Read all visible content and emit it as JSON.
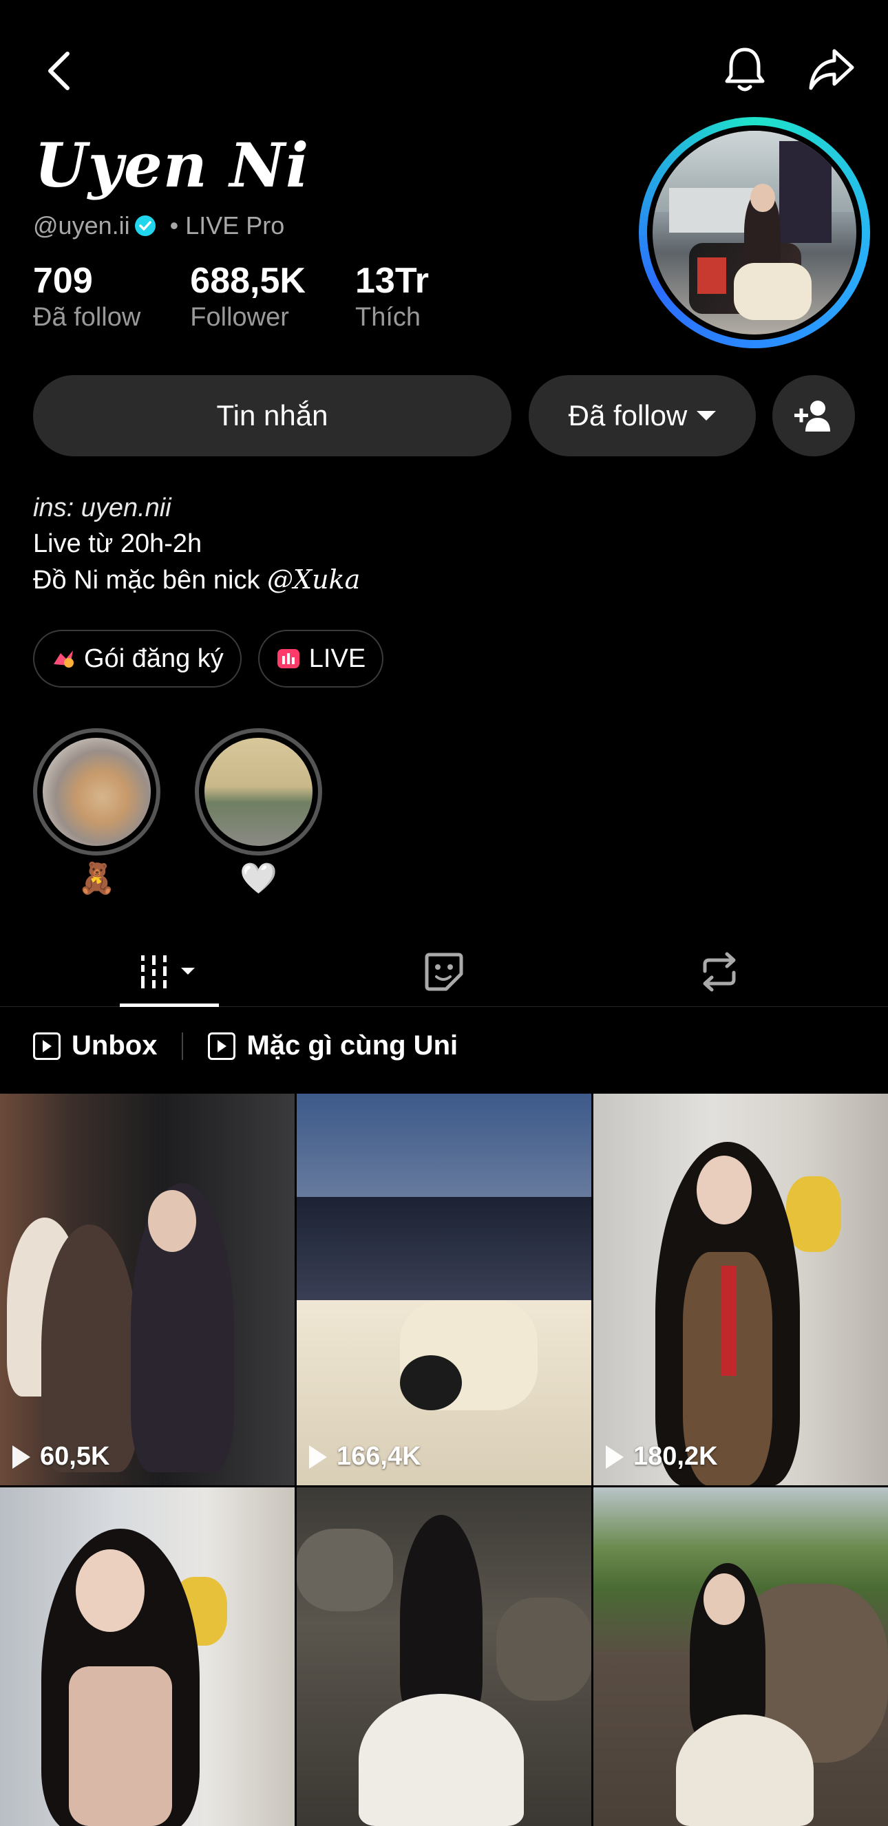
{
  "header": {
    "back_icon": "chevron-left-icon",
    "bell_icon": "bell-icon",
    "share_icon": "share-arrow-icon"
  },
  "profile": {
    "display_name": "Uyen Ni",
    "handle": "@uyen.ii",
    "badge": "LIVE Pro",
    "separator": "•",
    "stats": [
      {
        "value": "709",
        "label": "Đã follow"
      },
      {
        "value": "688,5K",
        "label": "Follower"
      },
      {
        "value": "13Tr",
        "label": "Thích"
      }
    ]
  },
  "actions": {
    "message_label": "Tin nhắn",
    "follow_label": "Đã follow",
    "add_friend_icon": "add-user-icon"
  },
  "bio": {
    "line1": "ins: uyen.nii",
    "line2": "Live từ 20h-2h",
    "line3_prefix": "Đồ Ni mặc bên nick ",
    "line3_mention": "@Xuka"
  },
  "chips": [
    {
      "label": "Gói đăng ký",
      "icon": "subscription-icon"
    },
    {
      "label": "LIVE",
      "icon": "live-icon"
    }
  ],
  "highlights": [
    {
      "emoji": "🧸"
    },
    {
      "emoji": "🤍"
    }
  ],
  "tabs": [
    {
      "name": "videos",
      "icon": "grid-icon",
      "active": true
    },
    {
      "name": "stickers",
      "icon": "sticker-icon",
      "active": false
    },
    {
      "name": "reposts",
      "icon": "repost-icon",
      "active": false
    }
  ],
  "playlists": [
    {
      "label": "Unbox"
    },
    {
      "label": "Mặc gì cùng Uni"
    }
  ],
  "videos": [
    {
      "views": "60,5K"
    },
    {
      "views": "166,4K"
    },
    {
      "views": "180,2K"
    },
    {
      "views": ""
    },
    {
      "views": ""
    },
    {
      "views": ""
    }
  ],
  "colors": {
    "background": "#000000",
    "button_bg": "#2b2b2b",
    "verified": "#20d5ec",
    "avatar_ring_a": "#1fe3c9",
    "avatar_ring_b": "#2b6dff"
  }
}
